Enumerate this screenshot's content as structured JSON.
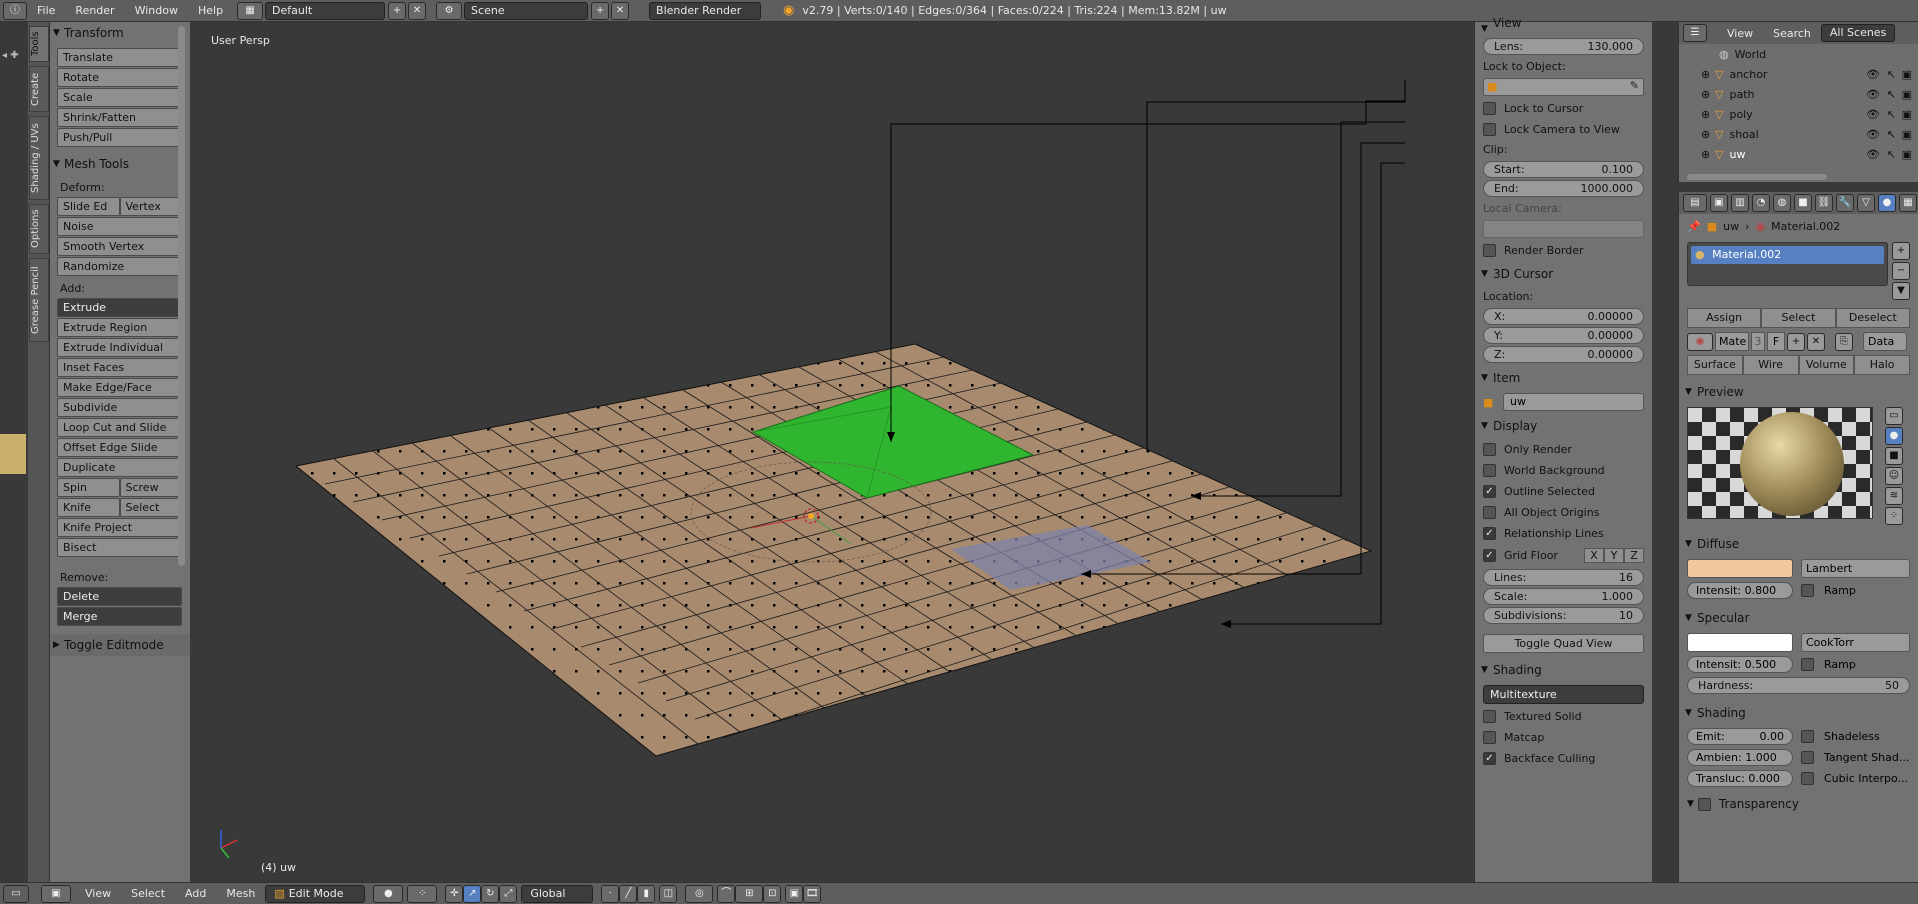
{
  "topbar": {
    "menus": [
      "File",
      "Render",
      "Window",
      "Help"
    ],
    "screen_layout": "Default",
    "scene": "Scene",
    "render_engine": "Blender Render",
    "stats": "v2.79 | Verts:0/140 | Edges:0/364 | Faces:0/224 | Tris:224 | Mem:13.82M | uw"
  },
  "sidetabs": [
    "Tools",
    "Create",
    "Shading / UVs",
    "Options",
    "Grease Pencil"
  ],
  "toolshelf": {
    "transform_title": "Transform",
    "transform_buttons": [
      "Translate",
      "Rotate",
      "Scale",
      "Shrink/Fatten",
      "Push/Pull"
    ],
    "mesh_tools_title": "Mesh Tools",
    "deform_label": "Deform:",
    "slide_edge": "Slide Ed",
    "vertex": "Vertex",
    "deform_buttons": [
      "Noise",
      "Smooth Vertex",
      "Randomize"
    ],
    "add_label": "Add:",
    "extrude": "Extrude",
    "add_buttons": [
      "Extrude Region",
      "Extrude Individual",
      "Inset Faces",
      "Make Edge/Face",
      "Subdivide",
      "Loop Cut and Slide",
      "Offset Edge Slide",
      "Duplicate"
    ],
    "spin": "Spin",
    "screw": "Screw",
    "knife": "Knife",
    "select": "Select",
    "knife_project": "Knife Project",
    "bisect": "Bisect",
    "remove_label": "Remove:",
    "delete": "Delete",
    "merge": "Merge",
    "toggle_editmode": "Toggle Editmode"
  },
  "viewport": {
    "view_label": "User Persp",
    "object_label": "(4) uw"
  },
  "props": {
    "view_title": "View",
    "lens_label": "Lens:",
    "lens_value": "130.000",
    "lock_to_object": "Lock to Object:",
    "lock_to_cursor": "Lock to Cursor",
    "lock_camera": "Lock Camera to View",
    "clip_label": "Clip:",
    "clip_start_label": "Start:",
    "clip_start": "0.100",
    "clip_end_label": "End:",
    "clip_end": "1000.000",
    "local_camera": "Local Camera:",
    "render_border": "Render Border",
    "cursor_title": "3D Cursor",
    "location_label": "Location:",
    "x_label": "X:",
    "x_value": "0.00000",
    "y_label": "Y:",
    "y_value": "0.00000",
    "z_label": "Z:",
    "z_value": "0.00000",
    "item_title": "Item",
    "item_name": "uw",
    "display_title": "Display",
    "only_render": "Only Render",
    "world_background": "World Background",
    "outline_selected": "Outline Selected",
    "all_object_origins": "All Object Origins",
    "relationship_lines": "Relationship Lines",
    "grid_floor": "Grid Floor",
    "axis_x": "X",
    "axis_y": "Y",
    "axis_z": "Z",
    "lines_label": "Lines:",
    "lines_value": "16",
    "scale_label": "Scale:",
    "scale_value": "1.000",
    "subdiv_label": "Subdivisions:",
    "subdiv_value": "10",
    "toggle_quad": "Toggle Quad View",
    "shading_title": "Shading",
    "shading_mode": "Multitexture",
    "textured_solid": "Textured Solid",
    "matcap": "Matcap",
    "backface_culling": "Backface Culling"
  },
  "outliner": {
    "menus": [
      "View",
      "Search"
    ],
    "scene_filter": "All Scenes",
    "world": "World",
    "objects": [
      "anchor",
      "path",
      "poly",
      "shoal",
      "uw"
    ]
  },
  "material": {
    "breadcrumb_object": "uw",
    "breadcrumb_material": "Material.002",
    "slot_name": "Material.002",
    "assign": "Assign",
    "select": "Select",
    "deselect": "Deselect",
    "mat_name": "Mate",
    "users": "3",
    "fake_user": "F",
    "link": "Data",
    "tabs": [
      "Surface",
      "Wire",
      "Volume",
      "Halo"
    ],
    "preview_title": "Preview",
    "diffuse_title": "Diffuse",
    "diffuse_color": "#f1c79d",
    "diffuse_shader": "Lambert",
    "diffuse_intensity": "Intensit: 0.800",
    "ramp": "Ramp",
    "specular_title": "Specular",
    "specular_shader": "CookTorr",
    "specular_intensity": "Intensit: 0.500",
    "hardness_label": "Hardness:",
    "hardness_value": "50",
    "shading_title": "Shading",
    "emit": "Emit:",
    "emit_value": "0.00",
    "ambient": "Ambien: 1.000",
    "transluc": "Transluc: 0.000",
    "shadeless": "Shadeless",
    "tangent": "Tangent Shad...",
    "cubic": "Cubic Interpo...",
    "transparency_title": "Transparency"
  },
  "bottombar": {
    "menus": [
      "View",
      "Select",
      "Add",
      "Mesh"
    ],
    "mode": "Edit Mode",
    "orientation": "Global"
  },
  "colors": {
    "mesh_fill": "#a88a6e",
    "green_face": "#2fb52f",
    "blue_face": "#7e82a8",
    "selection": "#5680c2"
  }
}
